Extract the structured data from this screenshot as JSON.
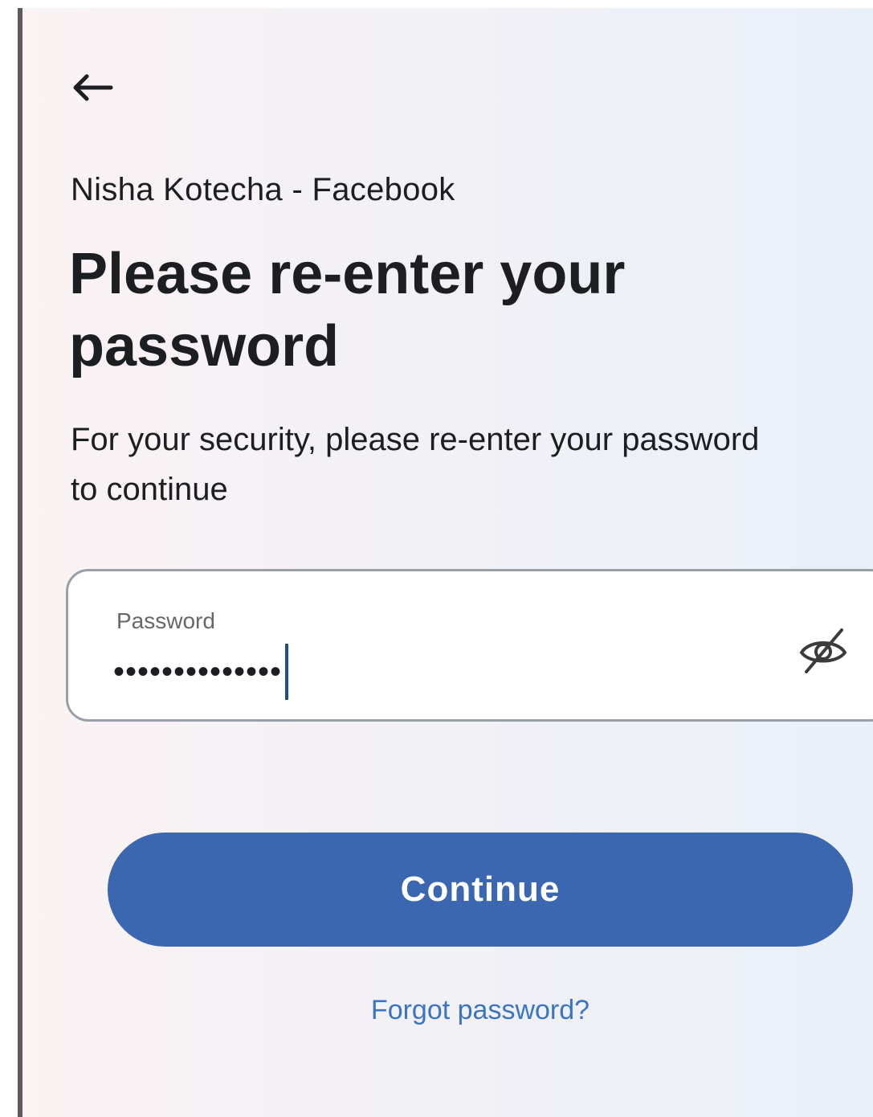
{
  "account": {
    "label": "Nisha Kotecha - Facebook"
  },
  "header": {
    "title": "Please re-enter your password",
    "subtitle": "For your security, please re-enter your password to continue"
  },
  "password_field": {
    "label": "Password",
    "masked_value": "••••••••••••••"
  },
  "actions": {
    "continue_label": "Continue",
    "forgot_label": "Forgot password?"
  },
  "icons": {
    "back": "arrow-left-icon",
    "visibility": "eye-off-icon"
  },
  "colors": {
    "primary": "#3a67b0",
    "link": "#3a75c4",
    "text": "#1c1e21",
    "caret": "#1f4f8a"
  }
}
